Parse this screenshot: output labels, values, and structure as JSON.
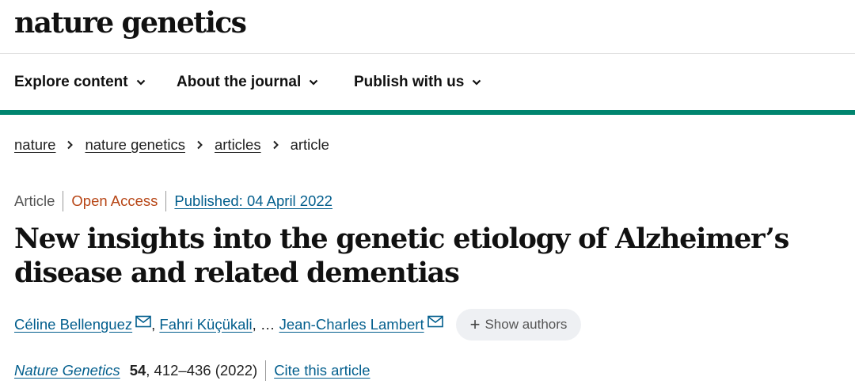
{
  "header": {
    "logo": "nature genetics"
  },
  "nav": {
    "items": [
      {
        "label": "Explore content",
        "icon": "chevron-down-icon"
      },
      {
        "label": "About the journal",
        "icon": "chevron-down-icon"
      },
      {
        "label": "Publish with us",
        "icon": "chevron-down-icon"
      }
    ]
  },
  "breadcrumb": {
    "items": [
      "nature",
      "nature genetics",
      "articles"
    ],
    "current": "article"
  },
  "article": {
    "type": "Article",
    "access": "Open Access",
    "published": "Published: 04 April 2022",
    "title": "New insights into the genetic etiology of Alzheimer’s disease and related dementias",
    "authors": {
      "first": "Céline Bellenguez",
      "second": "Fahri Küçükali",
      "last": "Jean-Charles Lambert",
      "show_authors_label": "Show authors"
    },
    "citation": {
      "journal": "Nature Genetics",
      "volume": "54",
      "pages": ", 412–436 (2022)",
      "cite_label": "Cite this article"
    }
  },
  "colors": {
    "accent_green": "#00856f",
    "link_blue": "#025e8d",
    "open_access": "#b74616"
  }
}
